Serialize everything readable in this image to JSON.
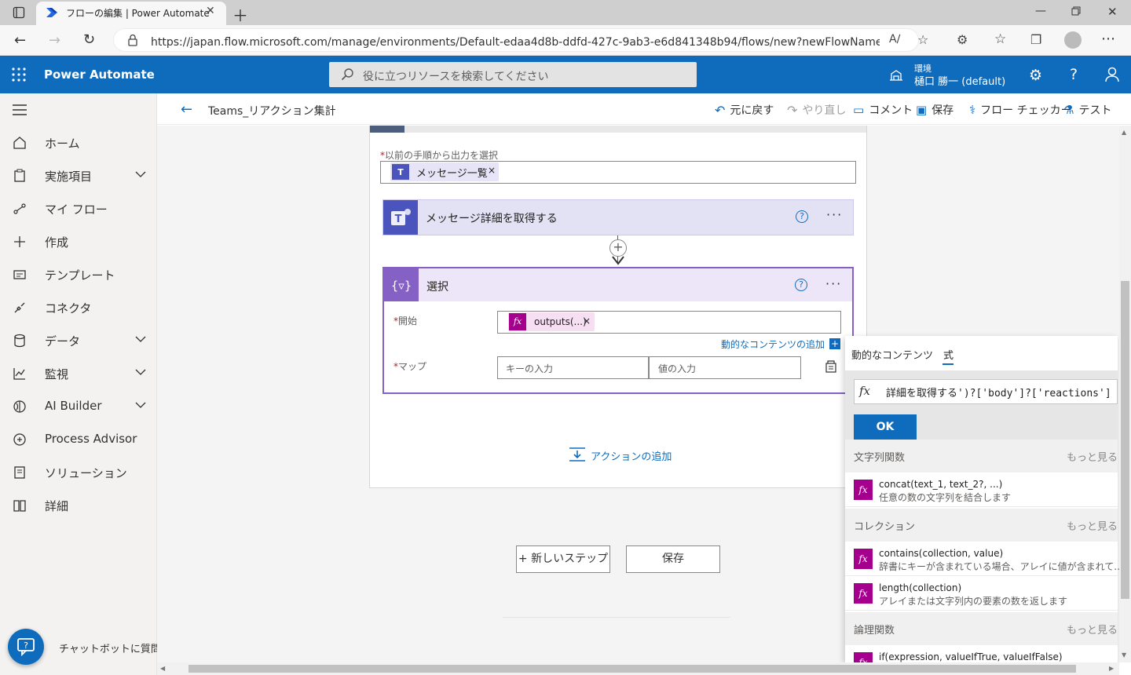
{
  "browser": {
    "tab_title": "フローの編集 | Power Automate",
    "url": "https://japan.flow.microsoft.com/manage/environments/Default-edaa4d8b-ddfd-427c-9ab3-e6d841348b94/flows/new?newFlowName=Teams_リアク..."
  },
  "header": {
    "app_name": "Power Automate",
    "search_placeholder": "役に立つリソースを検索してください",
    "env_label": "環境",
    "env_name": "樋口 勝一 (default)"
  },
  "nav": {
    "items": [
      {
        "label": "ホーム",
        "icon": "home-icon"
      },
      {
        "label": "実施項目",
        "icon": "clipboard-icon",
        "chevron": true
      },
      {
        "label": "マイ フロー",
        "icon": "flow-icon"
      },
      {
        "label": "作成",
        "icon": "plus-icon"
      },
      {
        "label": "テンプレート",
        "icon": "template-icon"
      },
      {
        "label": "コネクタ",
        "icon": "connector-icon"
      },
      {
        "label": "データ",
        "icon": "database-icon",
        "chevron": true
      },
      {
        "label": "監視",
        "icon": "monitor-icon",
        "chevron": true
      },
      {
        "label": "AI Builder",
        "icon": "ai-builder-icon",
        "chevron": true
      },
      {
        "label": "Process Advisor",
        "icon": "process-advisor-icon"
      },
      {
        "label": "ソリューション",
        "icon": "solution-icon"
      },
      {
        "label": "詳細",
        "icon": "book-icon"
      }
    ],
    "chatbot_label": "チャットボットに質問"
  },
  "commandbar": {
    "flow_name": "Teams_リアクション集計",
    "undo": "元に戻す",
    "redo": "やり直し",
    "comment": "コメント",
    "save": "保存",
    "checker": "フロー チェッカー",
    "test": "テスト"
  },
  "flow": {
    "prev_output_label": "以前の手順から出力を選択",
    "prev_output_token": "メッセージ一覧",
    "get_message_title": "メッセージ詳細を取得する",
    "select_title": "選択",
    "from_label": "開始",
    "from_token": "outputs(...)",
    "dynamic_link": "動的なコンテンツの追加",
    "map_label": "マップ",
    "key_placeholder": "キーの入力",
    "value_placeholder": "値の入力",
    "add_action": "アクションの追加",
    "new_step": "+ 新しいステップ",
    "save_button": "保存"
  },
  "expression_panel": {
    "tab_dynamic": "動的なコンテンツ",
    "tab_expression": "式",
    "expression_text": "詳細を取得する')?['body']?['reactions']",
    "ok_label": "OK",
    "more_label": "もっと見る",
    "sections": [
      {
        "title": "文字列関数",
        "functions": [
          {
            "name": "concat(text_1, text_2?, ...)",
            "desc": "任意の数の文字列を結合します"
          }
        ]
      },
      {
        "title": "コレクション",
        "functions": [
          {
            "name": "contains(collection, value)",
            "desc": "辞書にキーが含まれている場合、アレイに値が含まれて..."
          },
          {
            "name": "length(collection)",
            "desc": "アレイまたは文字列内の要素の数を返します"
          }
        ]
      },
      {
        "title": "論理関数",
        "functions": [
          {
            "name": "if(expression, valueIfTrue, valueIfFalse)",
            "desc": ""
          }
        ]
      }
    ]
  },
  "colors": {
    "brand_blue": "#0f6cbd",
    "select_purple": "#8661c5",
    "teams_purple": "#4b53bc",
    "fx_magenta": "#a4008d"
  }
}
